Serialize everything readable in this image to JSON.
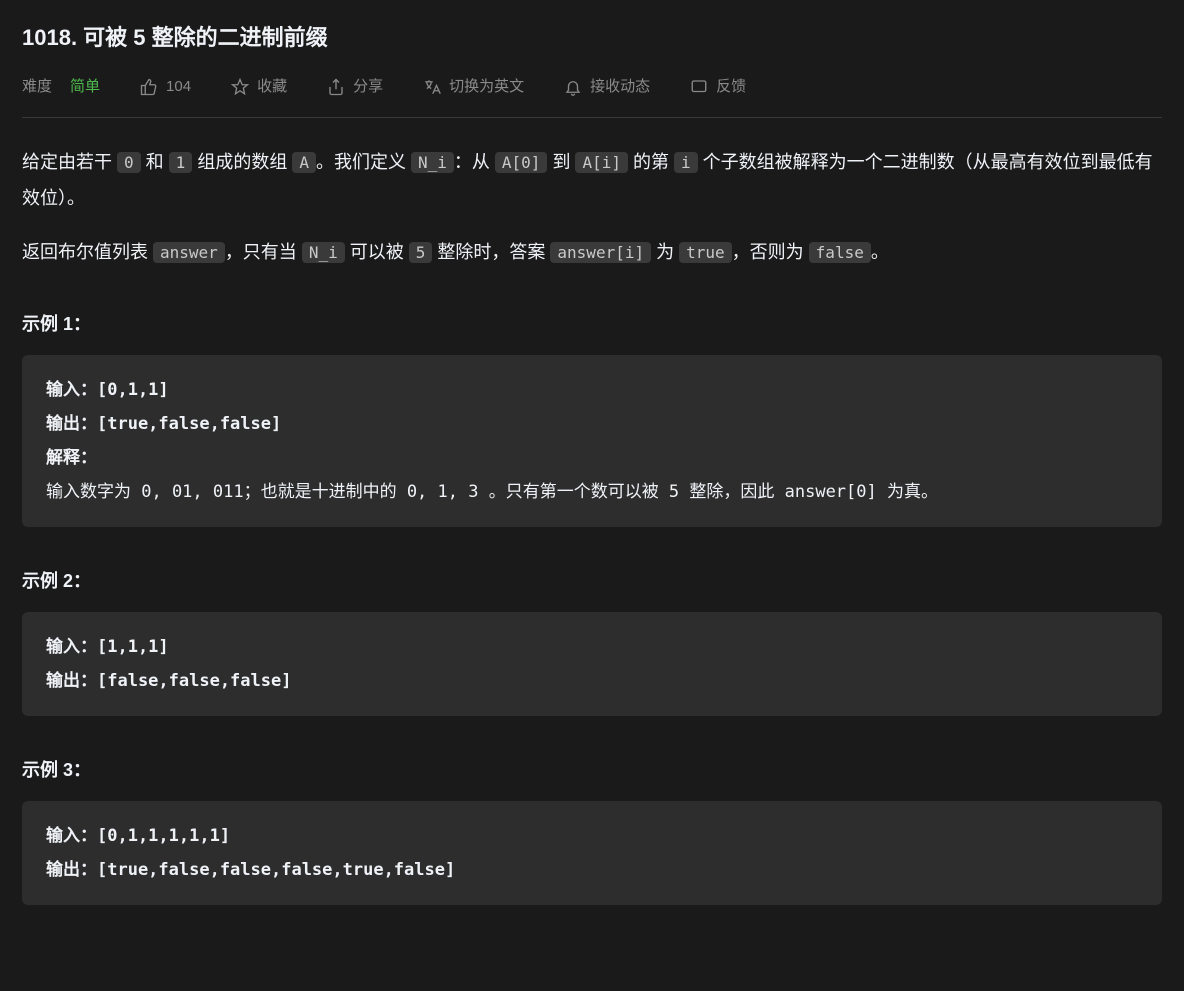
{
  "title": "1018. 可被 5 整除的二进制前缀",
  "toolbar": {
    "difficulty_label": "难度",
    "difficulty_value": "简单",
    "likes_count": "104",
    "favorite": "收藏",
    "share": "分享",
    "switch_lang": "切换为英文",
    "notifications": "接收动态",
    "feedback": "反馈"
  },
  "description": {
    "p1_a": "给定由若干 ",
    "c1": "0",
    "p1_b": " 和 ",
    "c2": "1",
    "p1_c": " 组成的数组 ",
    "c3": "A",
    "p1_d": "。我们定义 ",
    "c4": "N_i",
    "p1_e": "：从 ",
    "c5": "A[0]",
    "p1_f": " 到 ",
    "c6": "A[i]",
    "p1_g": " 的第 ",
    "c7": "i",
    "p1_h": " 个子数组被解释为一个二进制数（从最高有效位到最低有效位）。",
    "p2_a": "返回布尔值列表 ",
    "c8": "answer",
    "p2_b": "，只有当 ",
    "c9": "N_i",
    "p2_c": " 可以被 ",
    "c10": "5",
    "p2_d": " 整除时，答案 ",
    "c11": "answer[i]",
    "p2_e": " 为 ",
    "c12": "true",
    "p2_f": "，否则为 ",
    "c13": "false",
    "p2_g": "。"
  },
  "examples": [
    {
      "heading": "示例 1：",
      "input_label": "输入：",
      "input_value": "[0,1,1]",
      "output_label": "输出：",
      "output_value": "[true,false,false]",
      "explain_label": "解释：",
      "explain_value": "输入数字为 0, 01, 011；也就是十进制中的 0, 1, 3 。只有第一个数可以被 5 整除，因此 answer[0] 为真。"
    },
    {
      "heading": "示例 2：",
      "input_label": "输入：",
      "input_value": "[1,1,1]",
      "output_label": "输出：",
      "output_value": "[false,false,false]"
    },
    {
      "heading": "示例 3：",
      "input_label": "输入：",
      "input_value": "[0,1,1,1,1,1]",
      "output_label": "输出：",
      "output_value": "[true,false,false,false,true,false]"
    }
  ]
}
